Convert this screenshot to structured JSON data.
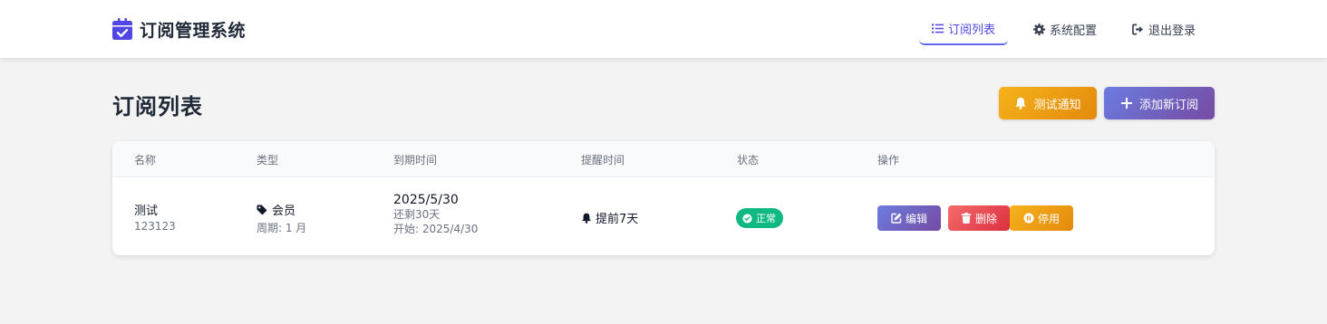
{
  "app": {
    "title": "订阅管理系统",
    "brand_icon": "calendar-check-icon",
    "accent_color": "#4f46e5"
  },
  "nav": {
    "items": [
      {
        "label": "订阅列表",
        "icon": "list-icon",
        "active": true
      },
      {
        "label": "系统配置",
        "icon": "gear-icon",
        "active": false
      },
      {
        "label": "退出登录",
        "icon": "sign-out-icon",
        "active": false
      }
    ]
  },
  "page": {
    "title": "订阅列表",
    "test_button": "测试通知",
    "add_button": "添加新订阅"
  },
  "table": {
    "headers": [
      "名称",
      "类型",
      "到期时间",
      "提醒时间",
      "状态",
      "操作"
    ],
    "rows": [
      {
        "name": "测试",
        "note": "123123",
        "type": "会员",
        "period": "周期: 1 月",
        "expiry_date": "2025/5/30",
        "remaining": "还剩30天",
        "start": "开始: 2025/4/30",
        "reminder": "提前7天",
        "status": "正常",
        "status_color": "#10b981",
        "actions": {
          "edit": "编辑",
          "delete": "删除",
          "pause": "停用"
        }
      }
    ]
  },
  "colors": {
    "warning": "#f59e0b",
    "danger": "#ef4444",
    "purple_gradient": [
      "#667eea",
      "#764ba2"
    ],
    "success": "#10b981"
  }
}
